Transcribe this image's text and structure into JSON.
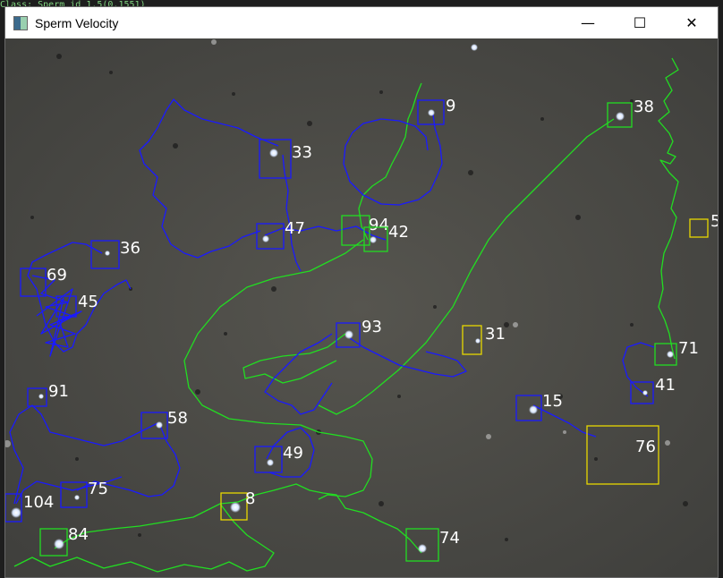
{
  "editor_bg_text": [
    "Class: Sperm id 1.5(0.1551)"
  ],
  "window": {
    "title": "Sperm Velocity"
  },
  "controls": {
    "minimize": "—",
    "maximize": "☐",
    "close": "✕"
  },
  "colors": {
    "blue": "#1a1aff",
    "green": "#22dd22",
    "yellow": "#e8d800",
    "frame_bg": "#4b4b48"
  },
  "tracked_sperm": [
    {
      "id": "9",
      "color": "blue"
    },
    {
      "id": "38",
      "color": "green"
    },
    {
      "id": "33",
      "color": "blue"
    },
    {
      "id": "94",
      "color": "green"
    },
    {
      "id": "42",
      "color": "green"
    },
    {
      "id": "47",
      "color": "blue"
    },
    {
      "id": "5",
      "color": "yellow"
    },
    {
      "id": "36",
      "color": "blue"
    },
    {
      "id": "69",
      "color": "blue"
    },
    {
      "id": "45",
      "color": "blue"
    },
    {
      "id": "93",
      "color": "blue"
    },
    {
      "id": "31",
      "color": "yellow"
    },
    {
      "id": "71",
      "color": "green"
    },
    {
      "id": "41",
      "color": "blue"
    },
    {
      "id": "91",
      "color": "blue"
    },
    {
      "id": "15",
      "color": "blue"
    },
    {
      "id": "58",
      "color": "blue"
    },
    {
      "id": "76",
      "color": "yellow"
    },
    {
      "id": "49",
      "color": "blue"
    },
    {
      "id": "75",
      "color": "blue"
    },
    {
      "id": "104",
      "color": "blue"
    },
    {
      "id": "8",
      "color": "yellow"
    },
    {
      "id": "84",
      "color": "green"
    },
    {
      "id": "74",
      "color": "green"
    }
  ]
}
